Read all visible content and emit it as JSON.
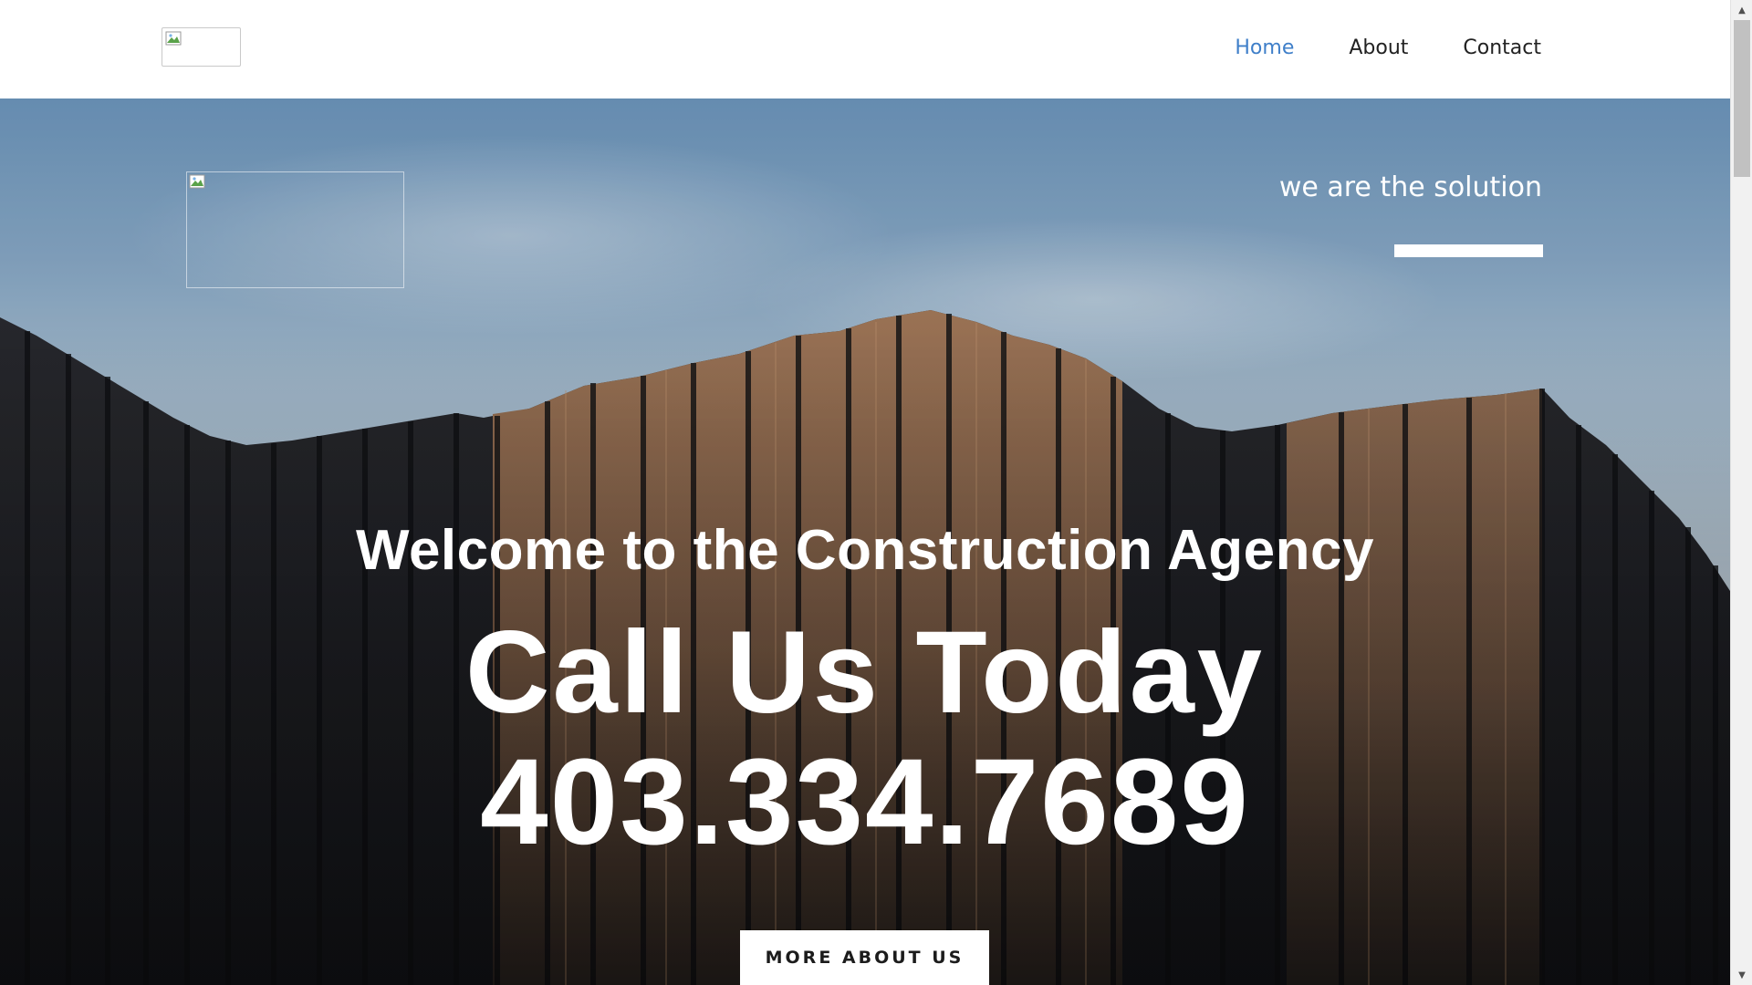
{
  "header": {
    "logo_alt": "",
    "nav": [
      {
        "label": "Home",
        "active": true
      },
      {
        "label": "About",
        "active": false
      },
      {
        "label": "Contact",
        "active": false
      }
    ]
  },
  "hero": {
    "tagline": "we are the solution",
    "welcome": "Welcome to the Construction Agency",
    "call": "Call Us Today",
    "phone": "403.334.7689",
    "button_label": "MORE ABOUT US"
  },
  "colors": {
    "accent": "#3f7fc9",
    "text_dark": "#222222",
    "hero_text": "#ffffff",
    "sky": "#89aac8"
  },
  "icons": [
    "broken-image-icon",
    "chevron-up-icon",
    "chevron-down-icon"
  ]
}
